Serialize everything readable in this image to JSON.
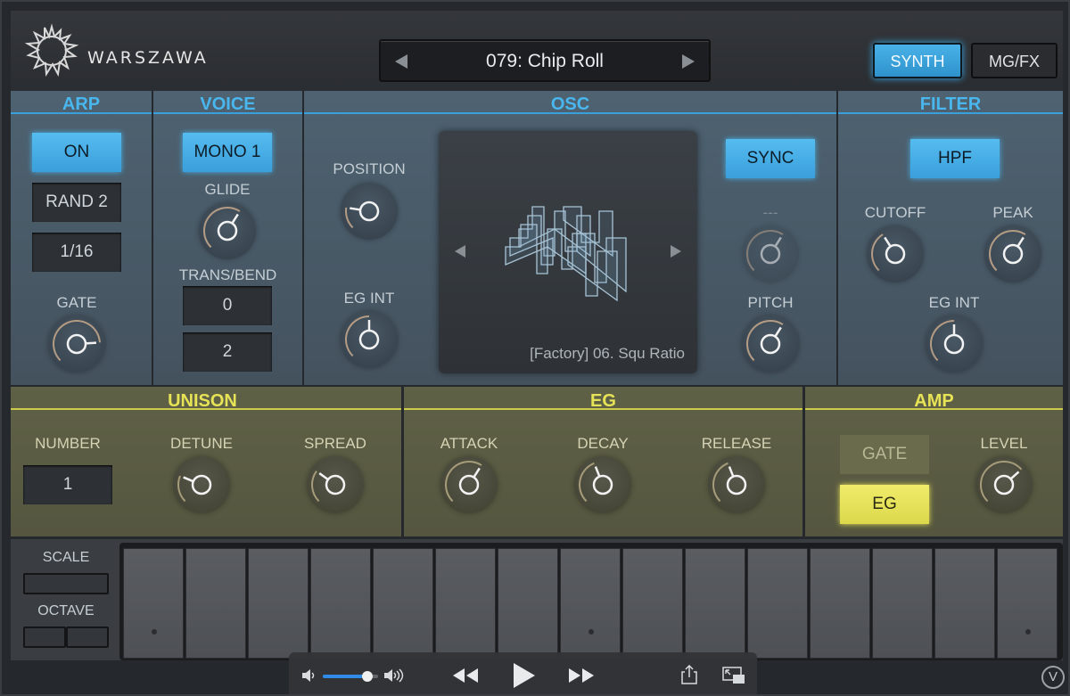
{
  "header": {
    "logo_text": "WARSZAWA",
    "preset_name": "079: Chip Roll",
    "synth_label": "SYNTH",
    "mgfx_label": "MG/FX"
  },
  "arp": {
    "title": "ARP",
    "on_label": "ON",
    "type_value": "RAND 2",
    "rate_value": "1/16",
    "gate_label": "GATE"
  },
  "voice": {
    "title": "VOICE",
    "mode_label": "MONO 1",
    "glide_label": "GLIDE",
    "trans_bend_label": "TRANS/BEND",
    "trans_value": "0",
    "bend_value": "2"
  },
  "osc": {
    "title": "OSC",
    "position_label": "POSITION",
    "eg_int_label": "EG INT",
    "wavetable_name": "[Factory] 06. Squ Ratio",
    "sync_label": "SYNC",
    "dash_label": "---",
    "pitch_label": "PITCH"
  },
  "filter": {
    "title": "FILTER",
    "type_label": "HPF",
    "cutoff_label": "CUTOFF",
    "peak_label": "PEAK",
    "eg_int_label": "EG INT"
  },
  "unison": {
    "title": "UNISON",
    "number_label": "NUMBER",
    "number_value": "1",
    "detune_label": "DETUNE",
    "spread_label": "SPREAD"
  },
  "eg": {
    "title": "EG",
    "attack_label": "ATTACK",
    "decay_label": "DECAY",
    "release_label": "RELEASE"
  },
  "amp": {
    "title": "AMP",
    "gate_label": "GATE",
    "eg_label": "EG",
    "level_label": "LEVEL"
  },
  "keyboard_panel": {
    "scale_label": "SCALE",
    "octave_label": "OCTAVE"
  },
  "transport": {
    "volume_fraction": 0.8,
    "collapse_label": "V"
  },
  "colors": {
    "blue_accent": "#49b6ee",
    "yellow_accent": "#e7e356",
    "blue_panel": "#4a5c6a",
    "yellow_panel": "#5b5d44"
  },
  "knob_values": {
    "arp_gate": 0.82,
    "voice_glide": 0.62,
    "osc_position": 0.2,
    "osc_eg_int": 0.5,
    "osc_unused": 0.62,
    "osc_pitch": 0.62,
    "filter_cutoff": 0.38,
    "filter_peak": 0.62,
    "filter_eg_int": 0.5,
    "unison_detune": 0.25,
    "unison_spread": 0.3,
    "eg_attack": 0.62,
    "eg_decay": 0.42,
    "eg_release": 0.42,
    "amp_level": 0.68
  }
}
